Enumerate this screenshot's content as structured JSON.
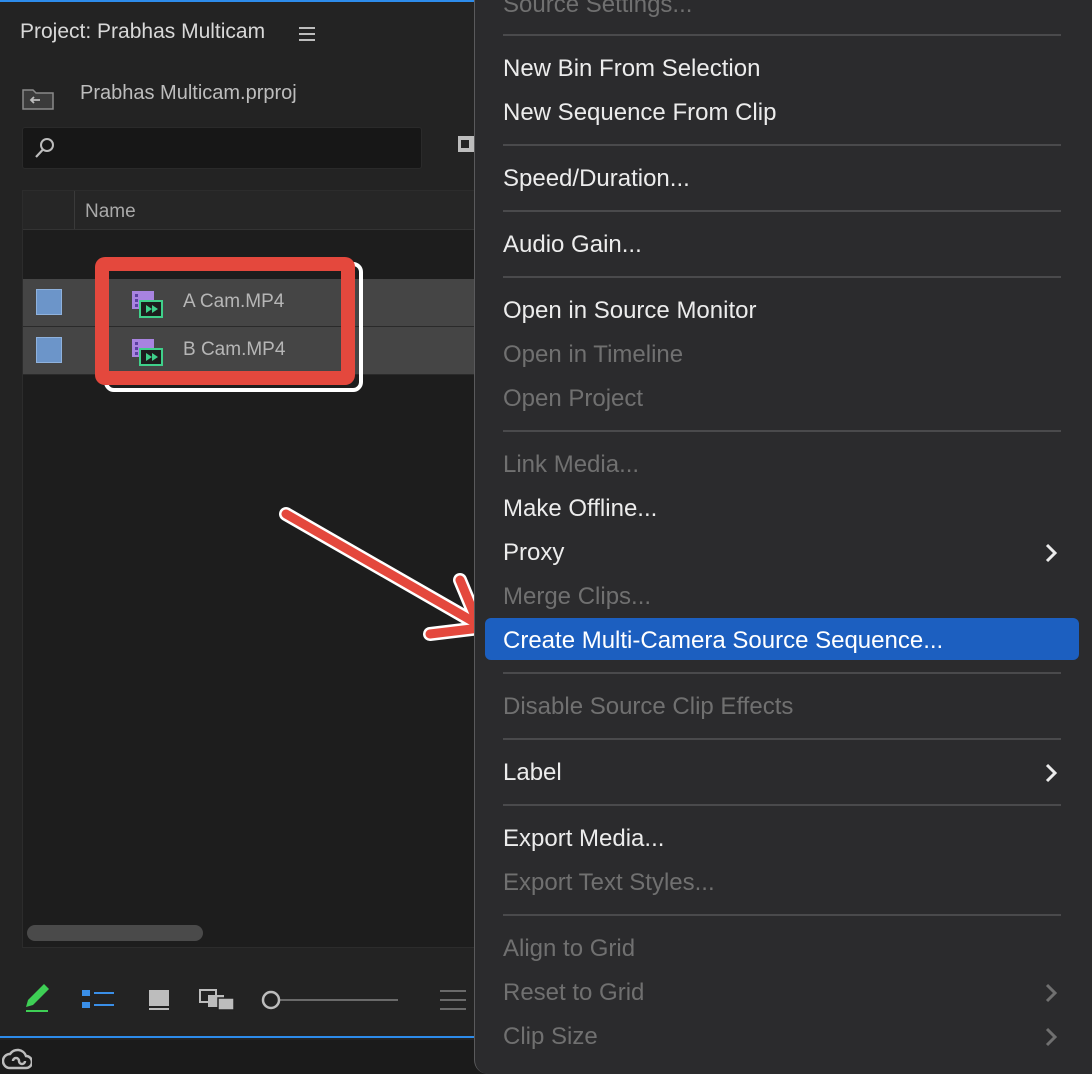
{
  "project": {
    "title": "Project: Prabhas Multicam",
    "bin_name": "Prabhas Multicam.prproj",
    "column_name": "Name",
    "clips": [
      {
        "name": "A Cam.MP4"
      },
      {
        "name": "B Cam.MP4"
      }
    ]
  },
  "menu": {
    "items": [
      {
        "label": "Source Settings...",
        "enabled": false
      },
      {
        "label": "New Bin From Selection",
        "enabled": true
      },
      {
        "label": "New Sequence From Clip",
        "enabled": true
      },
      {
        "label": "Speed/Duration...",
        "enabled": true
      },
      {
        "label": "Audio Gain...",
        "enabled": true
      },
      {
        "label": "Open in Source Monitor",
        "enabled": true
      },
      {
        "label": "Open in Timeline",
        "enabled": false
      },
      {
        "label": "Open Project",
        "enabled": false
      },
      {
        "label": "Link Media...",
        "enabled": false
      },
      {
        "label": "Make Offline...",
        "enabled": true
      },
      {
        "label": "Proxy",
        "enabled": true,
        "submenu": true
      },
      {
        "label": "Merge Clips...",
        "enabled": false
      },
      {
        "label": "Create Multi-Camera Source Sequence...",
        "enabled": true,
        "highlighted": true
      },
      {
        "label": "Disable Source Clip Effects",
        "enabled": false
      },
      {
        "label": "Label",
        "enabled": true,
        "submenu": true
      },
      {
        "label": "Export Media...",
        "enabled": true
      },
      {
        "label": "Export Text Styles...",
        "enabled": false
      },
      {
        "label": "Align to Grid",
        "enabled": false
      },
      {
        "label": "Reset to Grid",
        "enabled": false,
        "submenu": true
      },
      {
        "label": "Clip Size",
        "enabled": false,
        "submenu": true
      }
    ]
  },
  "colors": {
    "accent_blue": "#2d8ceb",
    "highlight": "#1c5fc0",
    "annotation_red": "#e4483d",
    "clip_label": "#6c95c9"
  },
  "icons": {
    "panel_menu": "hamburger-icon",
    "bin": "bin-icon",
    "search": "search-icon",
    "clip": "video-clip-icon",
    "submenu": "chevron-right-icon"
  }
}
